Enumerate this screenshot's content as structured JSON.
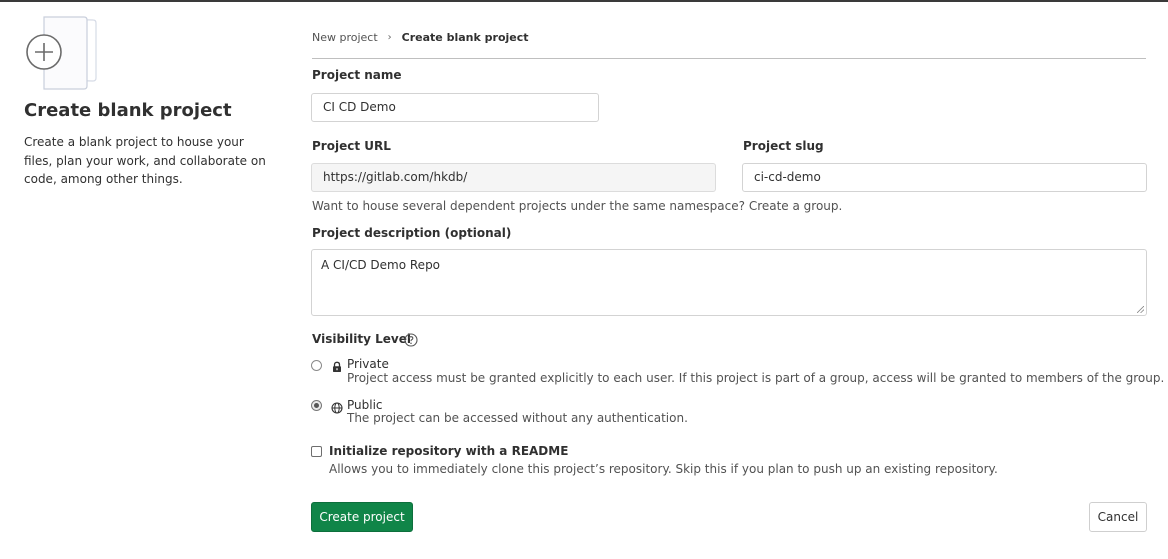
{
  "left_panel": {
    "illustration_icon": "plus-icon",
    "title": "Create blank project",
    "description": "Create a blank project to house your files, plan your work, and collaborate on code, among other things."
  },
  "breadcrumb": {
    "items": [
      "New project",
      "Create blank project"
    ],
    "separator_icon": "chevron-right-icon"
  },
  "form": {
    "project_name": {
      "label": "Project name",
      "value": "CI CD Demo"
    },
    "project_url": {
      "label": "Project URL",
      "value": "https://gitlab.com/hkdb/"
    },
    "project_slug": {
      "label": "Project slug",
      "value": "ci-cd-demo"
    },
    "namespace_hint": "Want to house several dependent projects under the same namespace? Create a group.",
    "description": {
      "label": "Project description (optional)",
      "value": "A CI/CD Demo Repo"
    },
    "visibility": {
      "label": "Visibility Level",
      "help_icon": "question-circle-icon",
      "selected": "public",
      "options": [
        {
          "id": "private",
          "icon": "lock-icon",
          "title": "Private",
          "description": "Project access must be granted explicitly to each user. If this project is part of a group, access will be granted to members of the group."
        },
        {
          "id": "public",
          "icon": "globe-icon",
          "title": "Public",
          "description": "The project can be accessed without any authentication."
        }
      ]
    },
    "readme": {
      "label": "Initialize repository with a README",
      "description": "Allows you to immediately clone this project’s repository. Skip this if you plan to push up an existing repository.",
      "checked": false
    }
  },
  "actions": {
    "create_label": "Create project",
    "cancel_label": "Cancel"
  },
  "colors": {
    "primary_button": "#108548",
    "text": "#303030",
    "muted_text": "#525252"
  }
}
